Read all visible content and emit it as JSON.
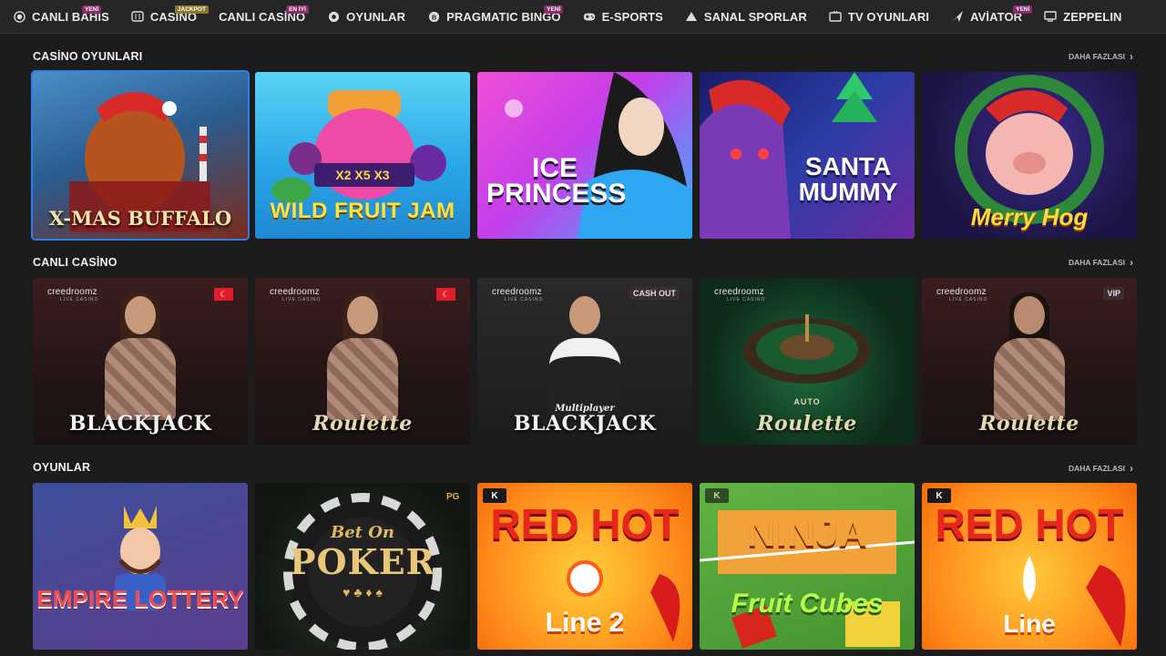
{
  "nav": {
    "items": [
      {
        "label": "CANLI BAHİS",
        "icon": "live-icon",
        "badge": "YENİ",
        "badge_type": "new"
      },
      {
        "label": "CASİNO",
        "icon": "slot-icon",
        "badge": "JACKPOT",
        "badge_type": "jackpot"
      },
      {
        "label": "CANLI CASİNO",
        "icon": "",
        "badge": "EN İYİ",
        "badge_type": "new"
      },
      {
        "label": "OYUNLAR",
        "icon": "gamepad-icon",
        "badge": "",
        "badge_type": ""
      },
      {
        "label": "PRAGMATIC BINGO",
        "icon": "bingo-icon",
        "badge": "YENİ",
        "badge_type": "new"
      },
      {
        "label": "E-SPORTS",
        "icon": "controller-icon",
        "badge": "",
        "badge_type": ""
      },
      {
        "label": "SANAL SPORLAR",
        "icon": "virtual-sports-icon",
        "badge": "",
        "badge_type": ""
      },
      {
        "label": "TV OYUNLARI",
        "icon": "tv-icon",
        "badge": "",
        "badge_type": ""
      },
      {
        "label": "AVİATOR",
        "icon": "plane-icon",
        "badge": "YENİ",
        "badge_type": "new"
      },
      {
        "label": "ZEPPELIN",
        "icon": "monitor-icon",
        "badge": "",
        "badge_type": ""
      }
    ]
  },
  "sections": {
    "casino": {
      "title": "CASİNO OYUNLARI",
      "more": "DAHA FAZLASI"
    },
    "live": {
      "title": "CANLI CASİNO",
      "more": "DAHA FAZLASI"
    },
    "games": {
      "title": "OYUNLAR",
      "more": "DAHA FAZLASI"
    }
  },
  "casino_games": [
    {
      "title": "X-MAS BUFFALO"
    },
    {
      "title": "WILD FRUIT JAM"
    },
    {
      "title": "ICE PRINCESS"
    },
    {
      "title": "SANTA MUMMY"
    },
    {
      "title": "Merry Hog"
    }
  ],
  "live_games": [
    {
      "provider": "creedroomz",
      "sub": "LIVE CASINO",
      "title": "BLACKJACK",
      "corner": "flag"
    },
    {
      "provider": "creedroomz",
      "sub": "LIVE CASINO",
      "title": "Roulette",
      "corner": "flag"
    },
    {
      "provider": "creedroomz",
      "sub": "LIVE CASINO",
      "title": "BLACKJACK",
      "subtitle": "Multiplayer",
      "corner": "CASH OUT"
    },
    {
      "provider": "creedroomz",
      "sub": "LIVE CASINO",
      "title": "Roulette",
      "subtitle": "AUTO",
      "corner": ""
    },
    {
      "provider": "creedroomz",
      "sub": "LIVE CASINO",
      "title": "Roulette",
      "corner": "VIP"
    }
  ],
  "games": [
    {
      "title": "EMPIRE LOTTERY"
    },
    {
      "title": "POKER",
      "subtitle": "Bet On"
    },
    {
      "title": "RED HOT",
      "subtitle": "Line 2"
    },
    {
      "title": "NINJA",
      "subtitle": "Fruit Cubes"
    },
    {
      "title": "RED HOT",
      "subtitle": "Line"
    }
  ],
  "colors": {
    "accent": "#2f7fe8",
    "badge_new": "#8a2c6b",
    "badge_jackpot": "#8a7a2c"
  }
}
